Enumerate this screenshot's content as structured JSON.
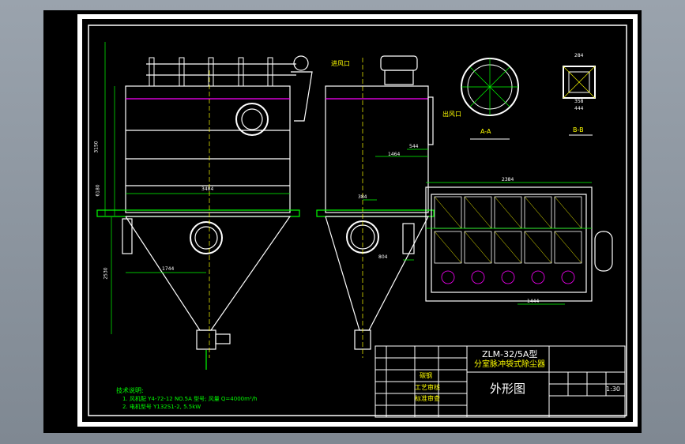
{
  "drawing": {
    "title_block": {
      "model": "ZLM-32/5A型",
      "product_name": "分室脉冲袋式除尘器",
      "view_name": "外形图",
      "scale": "1:30",
      "material": "碳钢",
      "left_stamp_1": "工艺审核",
      "left_stamp_2": "标准审查"
    },
    "annotations": {
      "inlet_label": "进风口",
      "outlet_label": "出风口",
      "section_label_1": "A-A",
      "section_label_2": "B-B",
      "tech_notes_title": "技术说明:",
      "tech_note_1": "1. 风机配 Y4-72-12 NO.5A 型号; 风量 Q=4000m³/h",
      "tech_note_2": "2. 电机型号 Y132S1-2, 5.5kW"
    },
    "dimensions": {
      "overall_width": "3484",
      "hopper_width": "1744",
      "top_width": "2384",
      "side_dim": "1464",
      "bottom_dim": "1444",
      "flange_1": "804",
      "flange_2": "384",
      "flange_3": "544",
      "square_top": "284",
      "square_inner": "358",
      "square_outer": "444",
      "height_1": "3150",
      "height_2": "6180",
      "height_3": "2530"
    },
    "colors": {
      "background": "#000000",
      "line": "#ffffff",
      "dim": "#00ff00",
      "accent": "#ff00ff",
      "yellow": "#ffff00"
    }
  }
}
